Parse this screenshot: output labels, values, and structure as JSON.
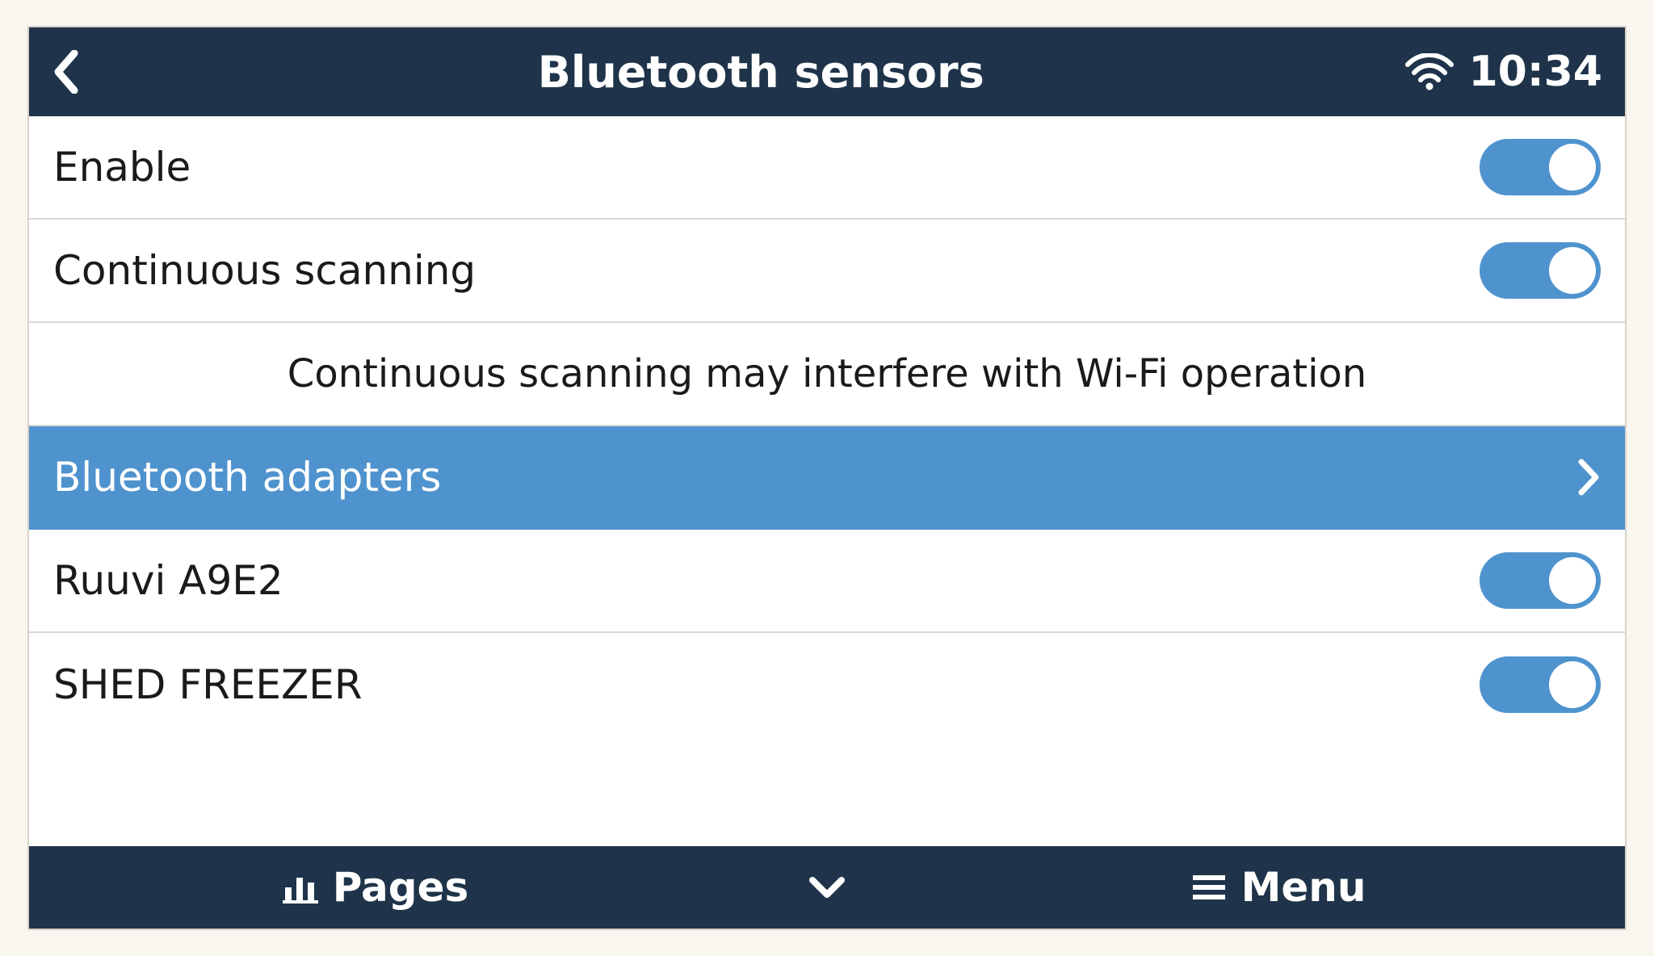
{
  "header": {
    "title": "Bluetooth sensors",
    "time": "10:34"
  },
  "rows": {
    "enable": {
      "label": "Enable"
    },
    "continuous": {
      "label": "Continuous scanning"
    },
    "note": {
      "text": "Continuous scanning may interfere with Wi-Fi operation"
    },
    "adapters": {
      "label": "Bluetooth adapters"
    },
    "ruuvi": {
      "label": "Ruuvi A9E2"
    },
    "shed": {
      "label": "SHED FREEZER"
    }
  },
  "footer": {
    "pages": "Pages",
    "menu": "Menu"
  }
}
